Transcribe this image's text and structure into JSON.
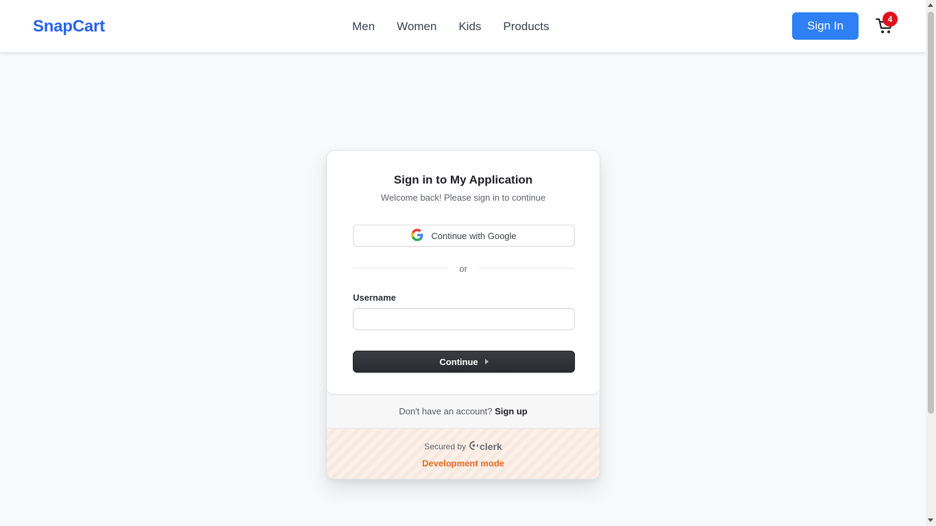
{
  "header": {
    "brand": "SnapCart",
    "nav": [
      {
        "label": "Men"
      },
      {
        "label": "Women"
      },
      {
        "label": "Kids"
      },
      {
        "label": "Products"
      }
    ],
    "sign_in_label": "Sign In",
    "cart_count": "4"
  },
  "auth_card": {
    "title": "Sign in to My Application",
    "subtitle": "Welcome back! Please sign in to continue",
    "google_label": "Continue with Google",
    "divider_text": "or",
    "username_label": "Username",
    "username_value": "",
    "continue_label": "Continue",
    "signup_prompt": "Don't have an account?",
    "signup_link": "Sign up",
    "secured_by": "Secured by",
    "clerk_brand": "clerk",
    "dev_mode": "Development mode"
  },
  "colors": {
    "brand": "#2563eb",
    "primary_button": "#2f80f5",
    "badge": "#e0101a",
    "dev_mode": "#e96b1f"
  },
  "icons": {
    "cart": "shopping-cart-icon",
    "google": "google-icon",
    "clerk": "clerk-logo-icon",
    "continue_arrow": "caret-right-icon"
  }
}
